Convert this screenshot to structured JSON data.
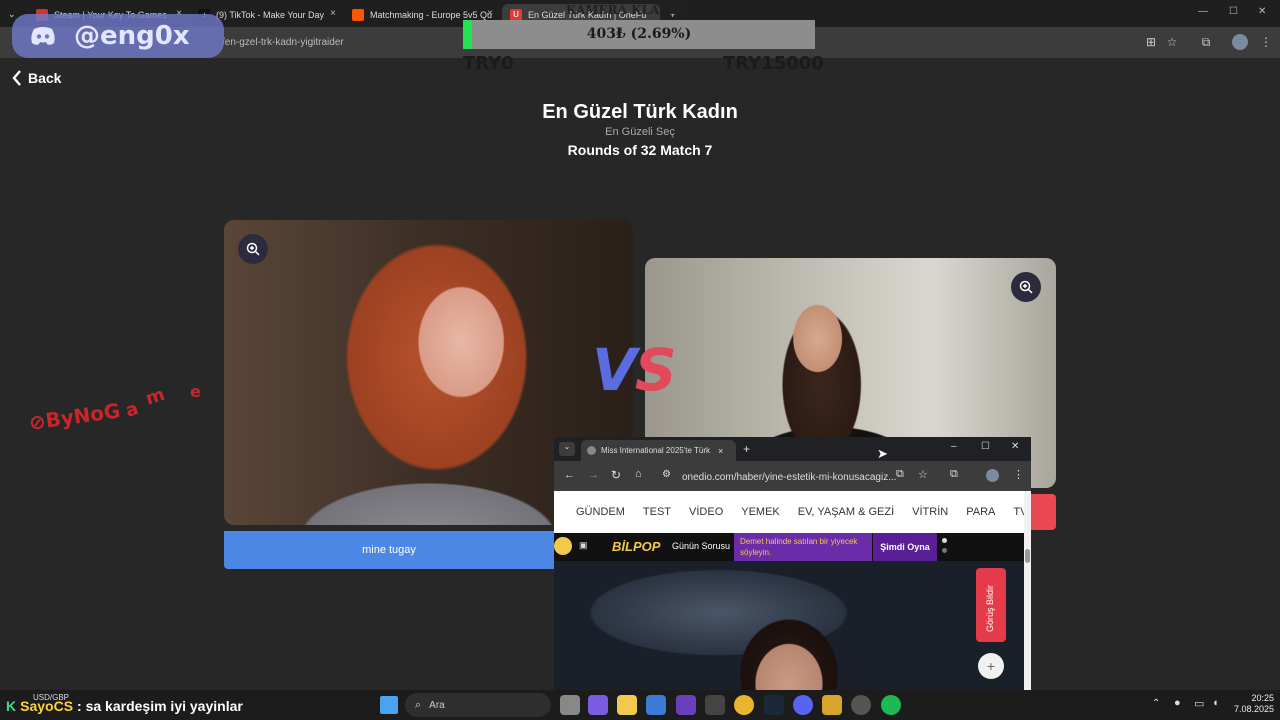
{
  "browser": {
    "tabs": [
      {
        "label": "Steam | Your Key To Games",
        "icon": "steam-icon"
      },
      {
        "label": "(9) TikTok - Make Your Day",
        "icon": "tiktok-icon"
      },
      {
        "label": "Matchmaking - Europe 5v5 Qu",
        "icon": "faceit-icon"
      },
      {
        "label": "En Güzel Türk Kadın | OneFu",
        "icon": "onefu-icon"
      }
    ],
    "url": "/en-gzel-trk-kadn-yigitraider"
  },
  "discord_overlay": {
    "name": "@eng0x",
    "icon": "discord-icon"
  },
  "donation": {
    "title": "KAMERA KLAVYE",
    "amount_text": "403₺ (2.69%)",
    "progress_percent": 2.69,
    "min_label": "TRY0",
    "max_label": "TRY15000"
  },
  "page": {
    "back_label": "Back",
    "title": "En Güzel Türk Kadın",
    "subtitle": "En Güzeli Seç",
    "round": "Rounds of 32 Match 7",
    "left_name": "mine tugay",
    "vs": {
      "v": "V",
      "s": "S"
    }
  },
  "watermark": {
    "logo": "ByNoGame"
  },
  "popup": {
    "tab_title": "Miss International 2025'te Türk",
    "url": "onedio.com/haber/yine-estetik-mi-konusacagiz...",
    "nav": [
      "GÜNDEM",
      "TEST",
      "VİDEO",
      "YEMEK",
      "EV, YAŞAM & GEZİ",
      "VİTRİN",
      "PARA",
      "TV & S"
    ],
    "banner": {
      "brand": "BİLPOP",
      "question_label": "Günün Sorusu",
      "question": "Demet halinde satılan bir yiyecek söyleyin.",
      "cta": "Şimdi Oyna"
    },
    "feedback": "Görüş Bildir"
  },
  "taskbar": {
    "chat_prefix": "K",
    "chat_user": "SayoCS",
    "chat_message": ": sa kardeşim iyi yayinlar",
    "currency": "USD/GBP",
    "search_placeholder": "Ara",
    "time": "20:25",
    "date": "7.08.2025"
  },
  "colors": {
    "blue_button": "#4d87e5",
    "red_button": "#e94852",
    "vs_v": "#5b6be0",
    "vs_s": "#e24a5c",
    "donation_fill": "#24e24f"
  }
}
